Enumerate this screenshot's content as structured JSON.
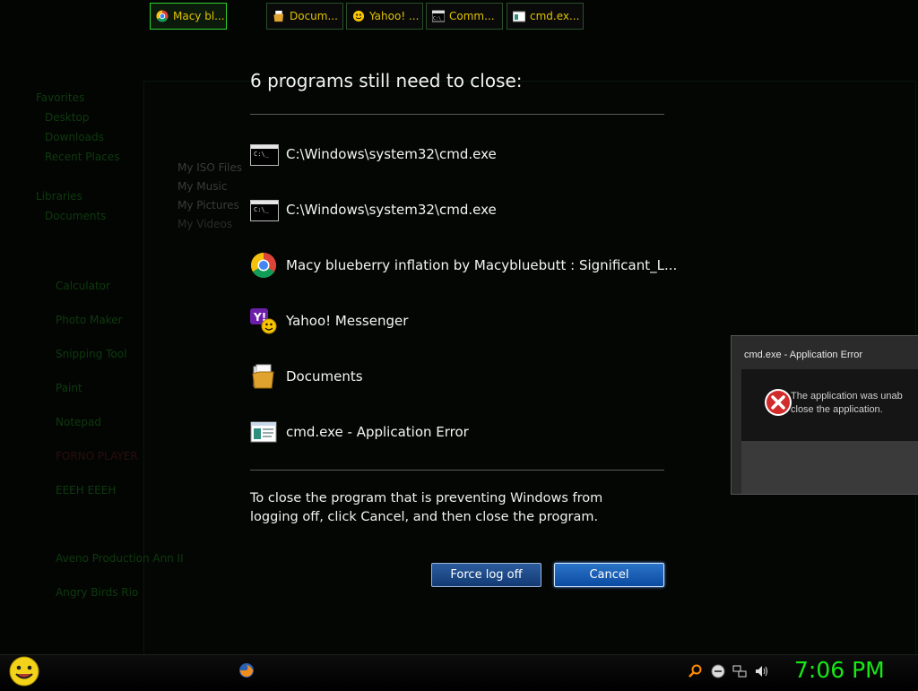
{
  "background": {
    "nav_items": [
      "Favorites",
      "Desktop",
      "Downloads",
      "Recent Places",
      "Libraries",
      "Documents"
    ],
    "files": [
      "My ISO Files",
      "My Music",
      "My Pictures",
      "My Videos"
    ],
    "start_items": [
      "Calculator",
      "Photo Maker",
      "Snipping Tool",
      "Paint",
      "Notepad",
      "FORNO PLAYER",
      "EEEH EEEH",
      "Aveno Production Ann II",
      "Angry Birds Rio"
    ]
  },
  "dialog": {
    "title": "6 programs still need to close:",
    "programs": [
      {
        "icon": "cmd-icon",
        "name": "C:\\Windows\\system32\\cmd.exe"
      },
      {
        "icon": "cmd-icon",
        "name": "C:\\Windows\\system32\\cmd.exe"
      },
      {
        "icon": "chrome-icon",
        "name": "Macy blueberry inflation by Macybluebutt : Significant_L..."
      },
      {
        "icon": "yahoo-messenger-icon",
        "name": "Yahoo! Messenger"
      },
      {
        "icon": "documents-folder-icon",
        "name": "Documents"
      },
      {
        "icon": "application-window-icon",
        "name": "cmd.exe - Application Error"
      }
    ],
    "message": "To close the program that is preventing Windows from logging off, click Cancel, and then close the program.",
    "force_button": "Force log off",
    "cancel_button": "Cancel"
  },
  "error_window": {
    "title": "cmd.exe - Application Error",
    "text_line1": "The application was unab",
    "text_line2": "close the application."
  },
  "taskbar": {
    "buttons": [
      {
        "icon": "chrome-icon",
        "label": "Macy bl...",
        "active": true
      },
      {
        "icon": "documents-folder-icon",
        "label": "Docum..."
      },
      {
        "icon": "yahoo-messenger-icon",
        "label": "Yahoo! ..."
      },
      {
        "icon": "cmd-icon",
        "label": "Comm..."
      },
      {
        "icon": "application-window-icon",
        "label": "cmd.ex..."
      }
    ],
    "clock": "7:06 PM"
  },
  "colors": {
    "clock": "#17e817",
    "taskbar_text": "#e0c200",
    "cancel_button": "#0b4ba2"
  }
}
